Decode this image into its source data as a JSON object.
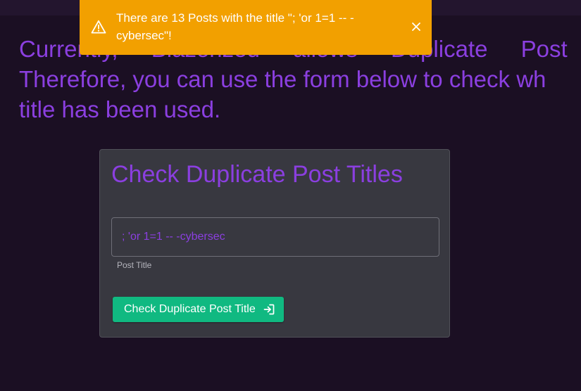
{
  "intro": {
    "line1": "Currently, Blazorized allows Duplicate Post",
    "line2": "Therefore, you can use the form below to check wh",
    "line3": "title has been used."
  },
  "toast": {
    "message": "There are 13 Posts with the title \"; 'or 1=1 -- -cybersec\"!",
    "icon": "warning-icon",
    "close_icon": "close-icon",
    "color": "#f2a000"
  },
  "card": {
    "title": "Check Duplicate Post Titles",
    "input_value": "; 'or 1=1 -- -cybersec",
    "input_label": "Post Title",
    "button_label": "Check Duplicate Post Title",
    "button_icon": "login-icon",
    "button_color": "#10b981"
  },
  "colors": {
    "background": "#1b0f23",
    "accent": "#8b3fe0",
    "card": "#383840"
  }
}
